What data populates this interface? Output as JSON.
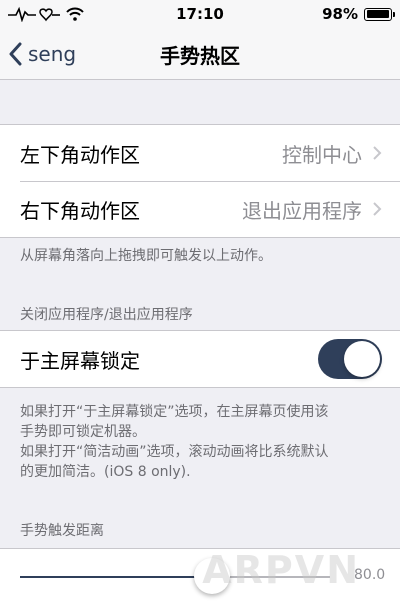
{
  "status_bar": {
    "time": "17:10",
    "battery_percent_label": "98%",
    "battery_level": 0.98
  },
  "nav": {
    "back_label": "seng",
    "title": "手势热区"
  },
  "corners": {
    "items": [
      {
        "label": "左下角动作区",
        "value": "控制中心"
      },
      {
        "label": "右下角动作区",
        "value": "退出应用程序"
      }
    ],
    "footer": "从屏幕角落向上拖拽即可触发以上动作。"
  },
  "close_apps": {
    "header": "关闭应用程序/退出应用程序",
    "lock_label": "于主屏幕锁定",
    "lock_on": true,
    "footer_lines": [
      "如果打开“于主屏幕锁定”选项，在主屏幕页使用该",
      "手势即可锁定机器。",
      "如果打开“简洁动画”选项，滚动动画将比系统默认",
      "的更加简洁。(iOS 8 only)."
    ]
  },
  "distance": {
    "header": "手势触发距离",
    "value_label": "80.0",
    "fraction": 0.62
  },
  "watermark": "ARPVN",
  "colors": {
    "accent": "#2f3f5a",
    "background": "#efeff4",
    "secondary_text": "#8e8e93"
  }
}
